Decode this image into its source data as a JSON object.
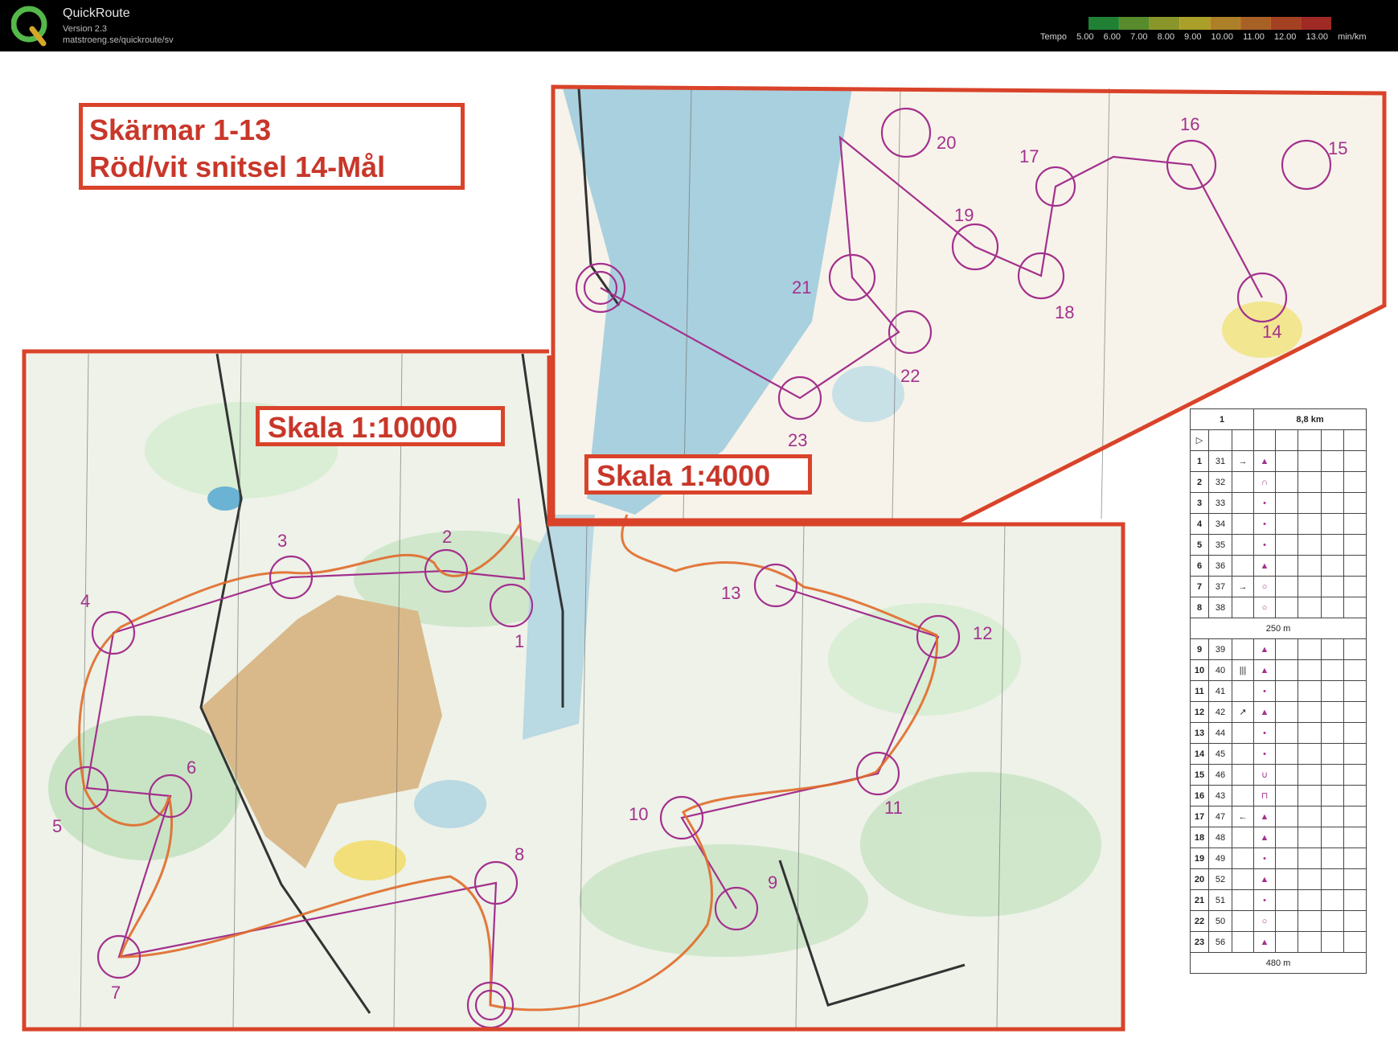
{
  "app": {
    "title": "QuickRoute",
    "version": "Version 2.3",
    "url": "matstroeng.se/quickroute/sv"
  },
  "legend": {
    "label": "Tempo",
    "values": [
      "5.00",
      "6.00",
      "7.00",
      "8.00",
      "9.00",
      "10.00",
      "11.00",
      "12.00",
      "13.00"
    ],
    "unit": "min/km",
    "colors": [
      "#2db84a",
      "#7cc63f",
      "#c3d63a",
      "#f2e23a",
      "#f5b73a",
      "#f08a35",
      "#e95c30",
      "#e23b35"
    ]
  },
  "map_labels": {
    "screens": "Skärmar 1-13",
    "tape": "Röd/vit snitsel 14-Mål",
    "scale_main": "Skala 1:10000",
    "scale_inset": "Skala 1:4000"
  },
  "controls": [
    "1",
    "2",
    "3",
    "4",
    "5",
    "6",
    "7",
    "8",
    "9",
    "10",
    "11",
    "12",
    "13",
    "14",
    "15",
    "16",
    "17",
    "18",
    "19",
    "20",
    "21",
    "22",
    "23"
  ],
  "description_table": {
    "header": {
      "course": "1",
      "length": "8,8 km"
    },
    "part1": [
      {
        "num": "1",
        "code": "31",
        "col3": "→",
        "col4": "▲"
      },
      {
        "num": "2",
        "code": "32",
        "col3": "",
        "col4": "∩"
      },
      {
        "num": "3",
        "code": "33",
        "col3": "",
        "col4": "•"
      },
      {
        "num": "4",
        "code": "34",
        "col3": "",
        "col4": "•"
      },
      {
        "num": "5",
        "code": "35",
        "col3": "",
        "col4": "•"
      },
      {
        "num": "6",
        "code": "36",
        "col3": "",
        "col4": "▲"
      },
      {
        "num": "7",
        "code": "37",
        "col3": "→",
        "col4": "○"
      },
      {
        "num": "8",
        "code": "38",
        "col3": "",
        "col4": "○"
      }
    ],
    "leg1": "250 m",
    "part2": [
      {
        "num": "9",
        "code": "39",
        "col3": "",
        "col4": "▲"
      },
      {
        "num": "10",
        "code": "40",
        "col3": "|||",
        "col4": "▲"
      },
      {
        "num": "11",
        "code": "41",
        "col3": "",
        "col4": "•"
      },
      {
        "num": "12",
        "code": "42",
        "col3": "↗",
        "col4": "▲"
      },
      {
        "num": "13",
        "code": "44",
        "col3": "",
        "col4": "•"
      },
      {
        "num": "14",
        "code": "45",
        "col3": "",
        "col4": "•"
      },
      {
        "num": "15",
        "code": "46",
        "col3": "",
        "col4": "∪"
      },
      {
        "num": "16",
        "code": "43",
        "col3": "",
        "col4": "⊓"
      },
      {
        "num": "17",
        "code": "47",
        "col3": "←",
        "col4": "▲"
      },
      {
        "num": "18",
        "code": "48",
        "col3": "",
        "col4": "▲"
      },
      {
        "num": "19",
        "code": "49",
        "col3": "",
        "col4": "•"
      },
      {
        "num": "20",
        "code": "52",
        "col3": "",
        "col4": "▲"
      },
      {
        "num": "21",
        "code": "51",
        "col3": "",
        "col4": "•"
      },
      {
        "num": "22",
        "code": "50",
        "col3": "",
        "col4": "○"
      },
      {
        "num": "23",
        "code": "56",
        "col3": "",
        "col4": "▲"
      }
    ],
    "leg2": "480 m"
  }
}
